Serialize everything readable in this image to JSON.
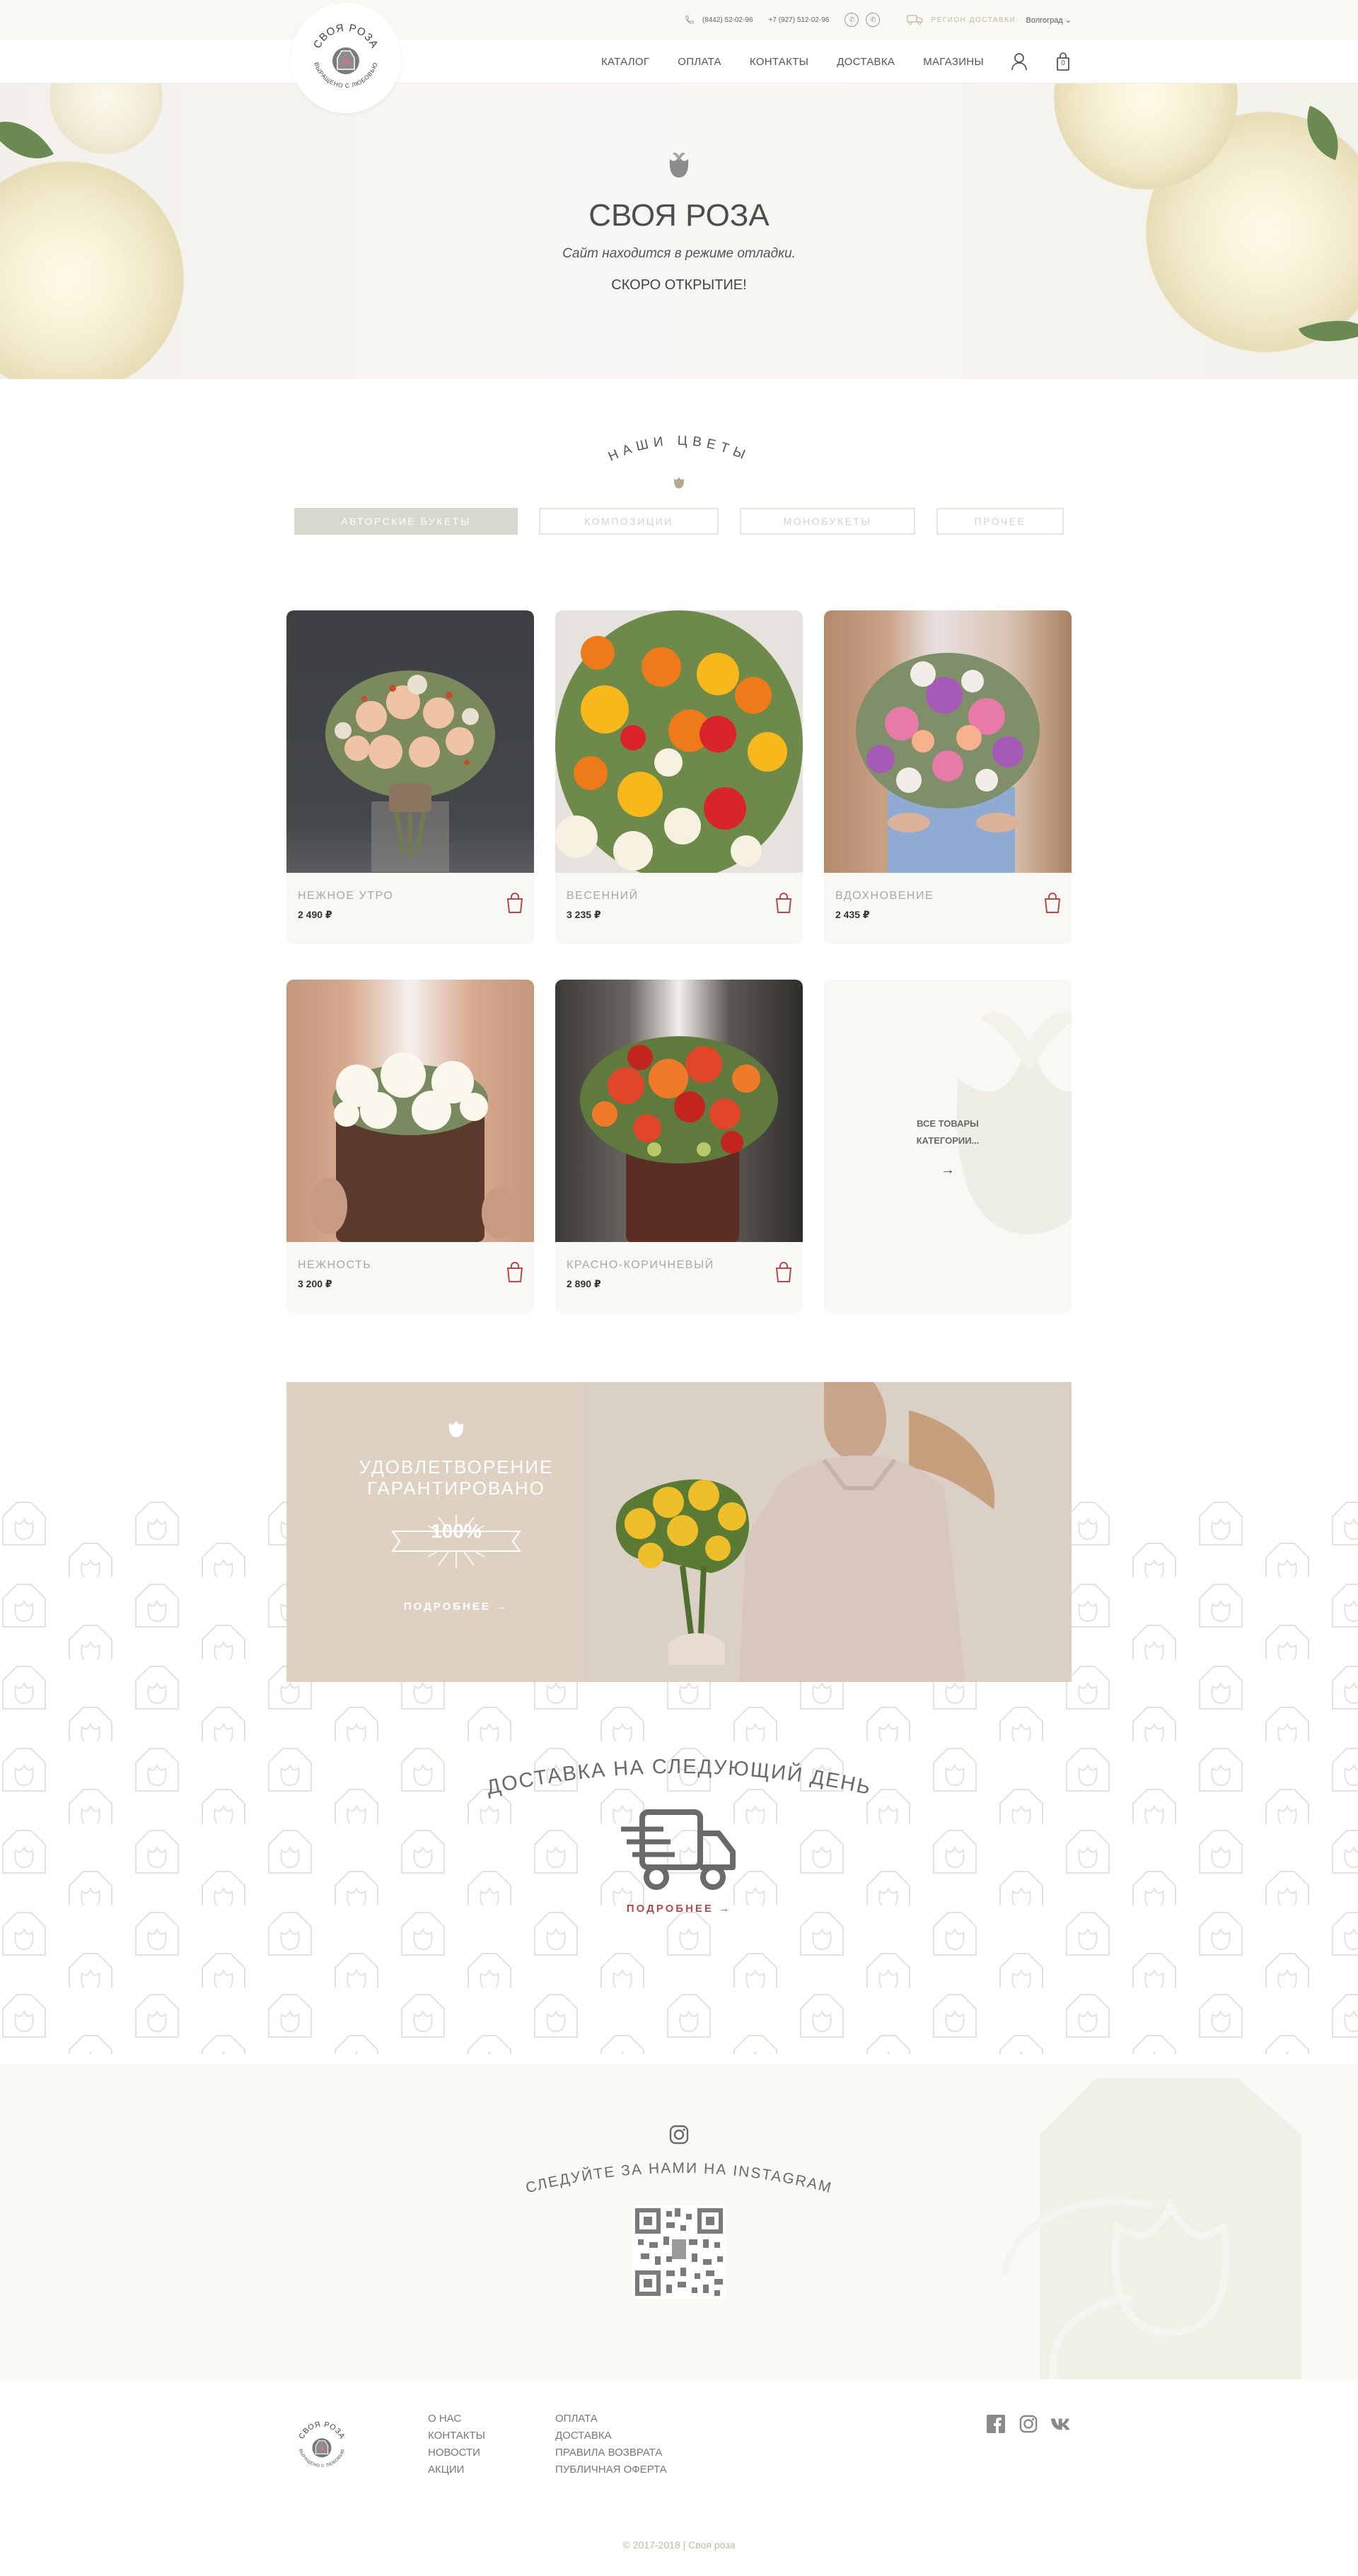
{
  "topbar": {
    "phone1": "(8442) 52-02-96",
    "phone2": "+7 (927) 512-02-96",
    "viber_icon": "viber-icon",
    "whatsapp_icon": "whatsapp-icon",
    "region_label": "РЕГИОН ДОСТАВКИ:",
    "region_value": "Волгоград"
  },
  "logo": {
    "top_text": "СВОЯ РОЗА",
    "bottom_text": "ВЫРАЩЕНО С ЛЮБОВЬЮ"
  },
  "nav": {
    "items": [
      "КАТАЛОГ",
      "ОПЛАТА",
      "КОНТАКТЫ",
      "ДОСТАВКА",
      "МАГАЗИНЫ"
    ],
    "cart_count": "0"
  },
  "hero": {
    "title": "СВОЯ РОЗА",
    "subtitle": "Сайт находится в режиме отладки.",
    "soon": "СКОРО ОТКРЫТИЕ!"
  },
  "catalog": {
    "title": "НАШИ ЦВЕТЫ",
    "filters": [
      "АВТОРСКИЕ БУКЕТЫ",
      "КОМПОЗИЦИИ",
      "МОНОБУКЕТЫ",
      "ПРОЧЕЕ"
    ],
    "active_filter": 0,
    "products": [
      {
        "name": "НЕЖНОЕ УТРО",
        "price": "2 490 ₽"
      },
      {
        "name": "ВЕСЕННИЙ",
        "price": "3 235 ₽"
      },
      {
        "name": "ВДОХНОВЕНИЕ",
        "price": "2 435 ₽"
      },
      {
        "name": "НЕЖНОСТЬ",
        "price": "3 200 ₽"
      },
      {
        "name": "КРАСНО-КОРИЧНЕВЫЙ",
        "price": "2 890 ₽"
      }
    ],
    "all_label": "ВСЕ ТОВАРЫ КАТЕГОРИИ...",
    "all_arrow": "→"
  },
  "banner": {
    "title": "УДОВЛЕТВОРЕНИЕ ГАРАНТИРОВАНО",
    "percent": "100%",
    "more": "ПОДРОБНЕЕ →"
  },
  "delivery": {
    "title": "ДОСТАВКА НА СЛЕДУЮЩИЙ ДЕНЬ",
    "more": "ПОДРОБНЕЕ →"
  },
  "instagram": {
    "title": "СЛЕДУЙТЕ ЗА НАМИ НА INSTAGRAM"
  },
  "footer": {
    "col1": [
      "О НАС",
      "КОНТАКТЫ",
      "НОВОСТИ",
      "АКЦИИ"
    ],
    "col2": [
      "ОПЛАТА",
      "ДОСТАВКА",
      "ПРАВИЛА ВОЗВРАТА",
      "ПУБЛИЧНАЯ ОФЕРТА"
    ],
    "socials": [
      "facebook-icon",
      "instagram-icon",
      "vk-icon"
    ],
    "copyright": "© 2017-2018 | Своя роза"
  },
  "colors": {
    "accent_red": "#b24a4a",
    "beige": "#c5b9a1",
    "bg_light": "#f9f9f3"
  }
}
